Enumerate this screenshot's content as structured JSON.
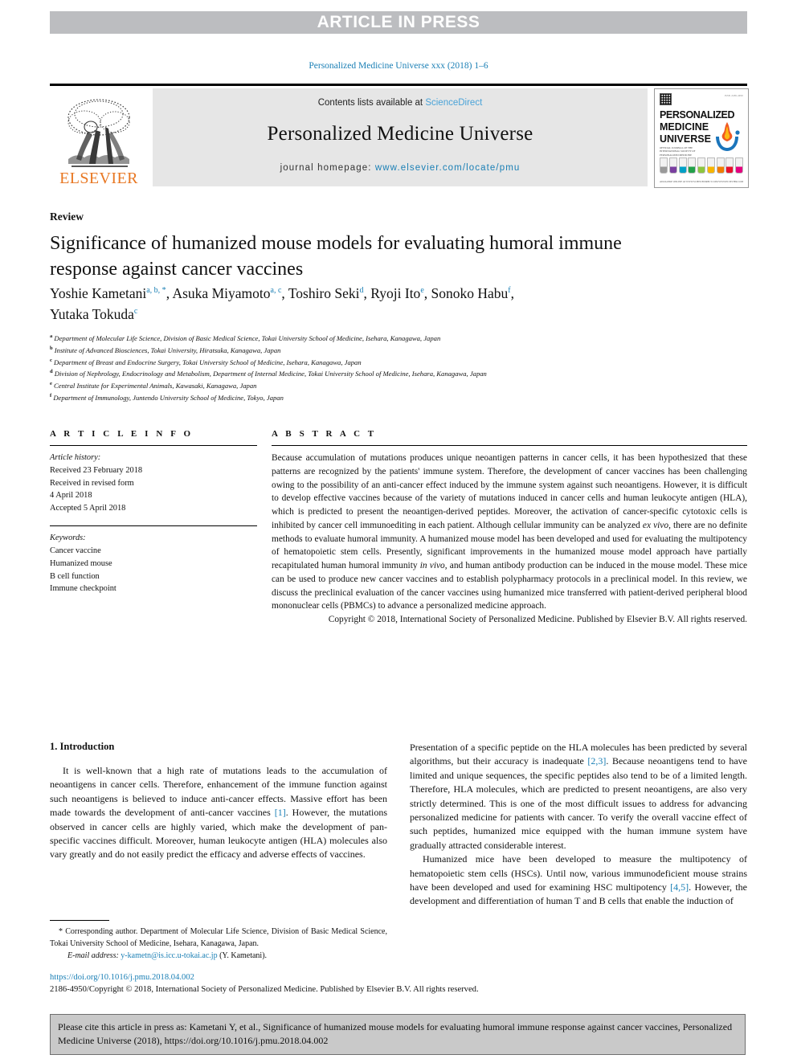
{
  "banner": {
    "text": "ARTICLE IN PRESS",
    "bg_color": "#bcbdc0"
  },
  "running_head": "Personalized Medicine Universe xxx (2018) 1–6",
  "masthead": {
    "publisher_wordmark": "ELSEVIER",
    "contents_prefix": "Contents lists available at ",
    "contents_link": "ScienceDirect",
    "journal_title": "Personalized Medicine Universe",
    "homepage_prefix": "journal homepage: ",
    "homepage_url": "www.elsevier.com/locate/pmu",
    "cover": {
      "line1": "PERSONALIZED",
      "line2": "MEDICINE",
      "line3": "UNIVERSE",
      "sub": "OFFICIAL JOURNAL OF THE INTERNATIONAL SOCIETY OF PERSONALIZED MEDICINE",
      "corner": "ISSN 2186-4950",
      "footer": "AVAILABLE ONLINE AT WWW.SCIENCEDIRECT.COM\nWWW.ELSEVIER.COM",
      "tube_colors": [
        "#9a9a9a",
        "#7a3fa0",
        "#00a0c6",
        "#22a14a",
        "#8dc63f",
        "#f7b500",
        "#f07d00",
        "#e8112d",
        "#e4007f"
      ]
    }
  },
  "doctype": "Review",
  "title": "Significance of humanized mouse models for evaluating humoral immune response against cancer vaccines",
  "authors": [
    {
      "name": "Yoshie Kametani",
      "marks": "a, b, *"
    },
    {
      "name": "Asuka Miyamoto",
      "marks": "a, c"
    },
    {
      "name": "Toshiro Seki",
      "marks": "d"
    },
    {
      "name": "Ryoji Ito",
      "marks": "e"
    },
    {
      "name": "Sonoko Habu",
      "marks": "f"
    },
    {
      "name": "Yutaka Tokuda",
      "marks": "c"
    }
  ],
  "affiliations": [
    {
      "mark": "a",
      "text": "Department of Molecular Life Science, Division of Basic Medical Science, Tokai University School of Medicine, Isehara, Kanagawa, Japan"
    },
    {
      "mark": "b",
      "text": "Institute of Advanced Biosciences, Tokai University, Hiratsuka, Kanagawa, Japan"
    },
    {
      "mark": "c",
      "text": "Department of Breast and Endocrine Surgery, Tokai University School of Medicine, Isehara, Kanagawa, Japan"
    },
    {
      "mark": "d",
      "text": "Division of Nephrology, Endocrinology and Metabolism, Department of Internal Medicine, Tokai University School of Medicine, Isehara, Kanagawa, Japan"
    },
    {
      "mark": "e",
      "text": "Central Institute for Experimental Animals, Kawasaki, Kanagawa, Japan"
    },
    {
      "mark": "f",
      "text": "Department of Immunology, Juntendo University School of Medicine, Tokyo, Japan"
    }
  ],
  "article_info": {
    "heading": "A R T I C L E  I N F O",
    "history_label": "Article history:",
    "history": [
      "Received 23 February 2018",
      "Received in revised form",
      "4 April 2018",
      "Accepted 5 April 2018"
    ],
    "keywords_label": "Keywords:",
    "keywords": [
      "Cancer vaccine",
      "Humanized mouse",
      "B cell function",
      "Immune checkpoint"
    ]
  },
  "abstract": {
    "heading": "A B S T R A C T",
    "body_part1": "Because accumulation of mutations produces unique neoantigen patterns in cancer cells, it has been hypothesized that these patterns are recognized by the patients' immune system. Therefore, the development of cancer vaccines has been challenging owing to the possibility of an anti-cancer effect induced by the immune system against such neoantigens. However, it is difficult to develop effective vaccines because of the variety of mutations induced in cancer cells and human leukocyte antigen (HLA), which is predicted to present the neoantigen-derived peptides. Moreover, the activation of cancer-specific cytotoxic cells is inhibited by cancer cell immunoediting in each patient. Although cellular immunity can be analyzed ",
    "italic1": "ex vivo",
    "body_part2": ", there are no definite methods to evaluate humoral immunity. A humanized mouse model has been developed and used for evaluating the multipotency of hematopoietic stem cells. Presently, significant improvements in the humanized mouse model approach have partially recapitulated human humoral immunity ",
    "italic2": "in vivo",
    "body_part3": ", and human antibody production can be induced in the mouse model. These mice can be used to produce new cancer vaccines and to establish polypharmacy protocols in a preclinical model. In this review, we discuss the preclinical evaluation of the cancer vaccines using humanized mice transferred with patient-derived peripheral blood mononuclear cells (PBMCs) to advance a personalized medicine approach.",
    "copyright": "Copyright © 2018, International Society of Personalized Medicine. Published by Elsevier B.V. All rights reserved."
  },
  "body": {
    "left": {
      "section_heading": "1. Introduction",
      "para1_a": "It is well-known that a high rate of mutations leads to the accumulation of neoantigens in cancer cells. Therefore, enhancement of the immune function against such neoantigens is believed to induce anti-cancer effects. Massive effort has been made towards the development of anti-cancer vaccines ",
      "ref1": "[1]",
      "para1_b": ". However, the mutations observed in cancer cells are highly varied, which make the development of pan-specific vaccines difficult. Moreover, human leukocyte antigen (HLA) molecules also vary greatly and do not easily predict the efficacy and adverse effects of vaccines."
    },
    "right": {
      "para1_a": "Presentation of a specific peptide on the HLA molecules has been predicted by several algorithms, but their accuracy is inadequate ",
      "ref1": "[2,3]",
      "para1_b": ". Because neoantigens tend to have limited and unique sequences, the specific peptides also tend to be of a limited length. Therefore, HLA molecules, which are predicted to present neoantigens, are also very strictly determined. This is one of the most difficult issues to address for advancing personalized medicine for patients with cancer. To verify the overall vaccine effect of such peptides, humanized mice equipped with the human immune system have gradually attracted considerable interest.",
      "para2_a": "Humanized mice have been developed to measure the multipotency of hematopoietic stem cells (HSCs). Until now, various immunodeficient mouse strains have been developed and used for examining HSC multipotency ",
      "ref2": "[4,5]",
      "para2_b": ". However, the development and differentiation of human T and B cells that enable the induction of"
    }
  },
  "footnote": {
    "text": "* Corresponding author. Department of Molecular Life Science, Division of Basic Medical Science, Tokai University School of Medicine, Isehara, Kanagawa, Japan.",
    "email_label": "E-mail address:",
    "email": "y-kametn@is.icc.u-tokai.ac.jp",
    "email_owner": "(Y. Kametani)."
  },
  "doi": {
    "url": "https://doi.org/10.1016/j.pmu.2018.04.002",
    "issn_line": "2186-4950/Copyright © 2018, International Society of Personalized Medicine. Published by Elsevier B.V. All rights reserved."
  },
  "citation_box": {
    "text": "Please cite this article in press as: Kametani Y, et al., Significance of humanized mouse models for evaluating humoral immune response against cancer vaccines, Personalized Medicine Universe (2018), https://doi.org/10.1016/j.pmu.2018.04.002"
  },
  "colors": {
    "link": "#1a7fb5",
    "sciencedirect": "#4aa3d8",
    "elsevier_orange": "#e87722",
    "banner_gray": "#bcbdc0",
    "masthead_gray": "#e6e6e6",
    "citebox_gray": "#c9c9c9"
  }
}
